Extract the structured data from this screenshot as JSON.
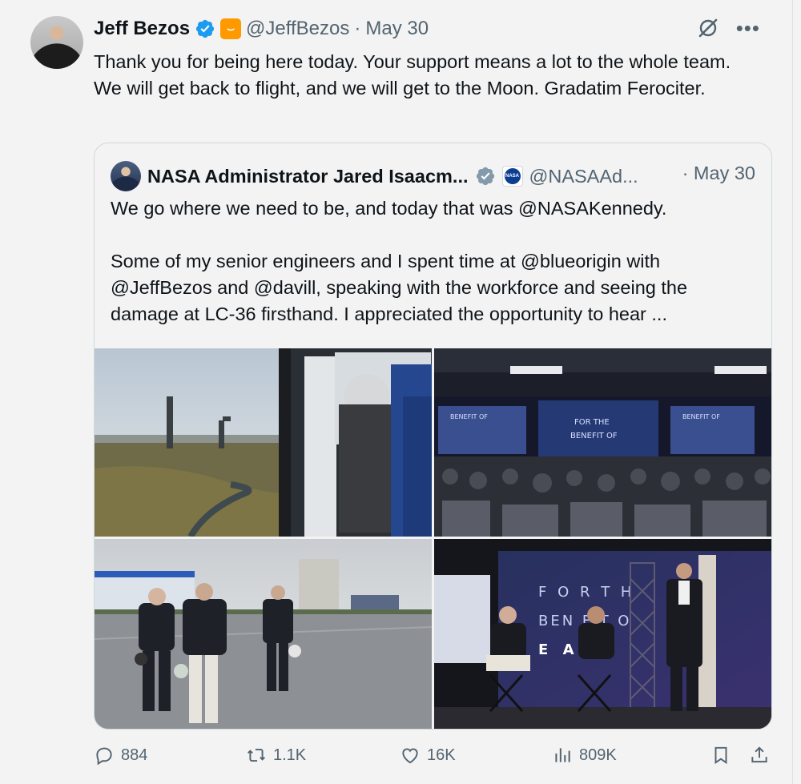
{
  "author": {
    "name": "Jeff Bezos",
    "handle": "@JeffBezos",
    "separator": "·",
    "date": "May 30",
    "brand_badge": "⌣"
  },
  "tweet": {
    "text": "Thank you for being here today. Your support means a lot to the whole team.  We will get back to flight, and we will get to the Moon. Gradatim Ferociter."
  },
  "quoted": {
    "name": "NASA Administrator Jared Isaacm...",
    "handle": "@NASAAd...",
    "date": "· May 30",
    "nasa_badge": "NASA",
    "paragraph1": "We go where we need to be, and today that was @NASAKennedy.",
    "paragraph2": "Some of my senior engineers and I spent time at @blueorigin with @JeffBezos and @davill, speaking with the workforce and seeing the damage at LC-36 firsthand. I appreciated the opportunity to hear ..."
  },
  "photos": {
    "stage_text_1": "F O R   T H",
    "stage_text_2": "BEN FIT O",
    "stage_text_3": "E   A   T",
    "screen_text_1": "FOR THE",
    "screen_text_2": "BENEFIT OF",
    "screen_left": "BENEFIT OF",
    "screen_right": "BENEFIT OF"
  },
  "actions": {
    "replies": "884",
    "reposts": "1.1K",
    "likes": "16K",
    "views": "809K"
  },
  "colors": {
    "verified_blue": "#1d9bf0",
    "muted": "#536471",
    "background": "#f3f3f3",
    "brand_orange": "#ff9900"
  },
  "icons": [
    "verified-icon",
    "grok-icon",
    "more-icon",
    "reply-icon",
    "repost-icon",
    "like-icon",
    "views-icon",
    "bookmark-icon",
    "share-icon"
  ]
}
